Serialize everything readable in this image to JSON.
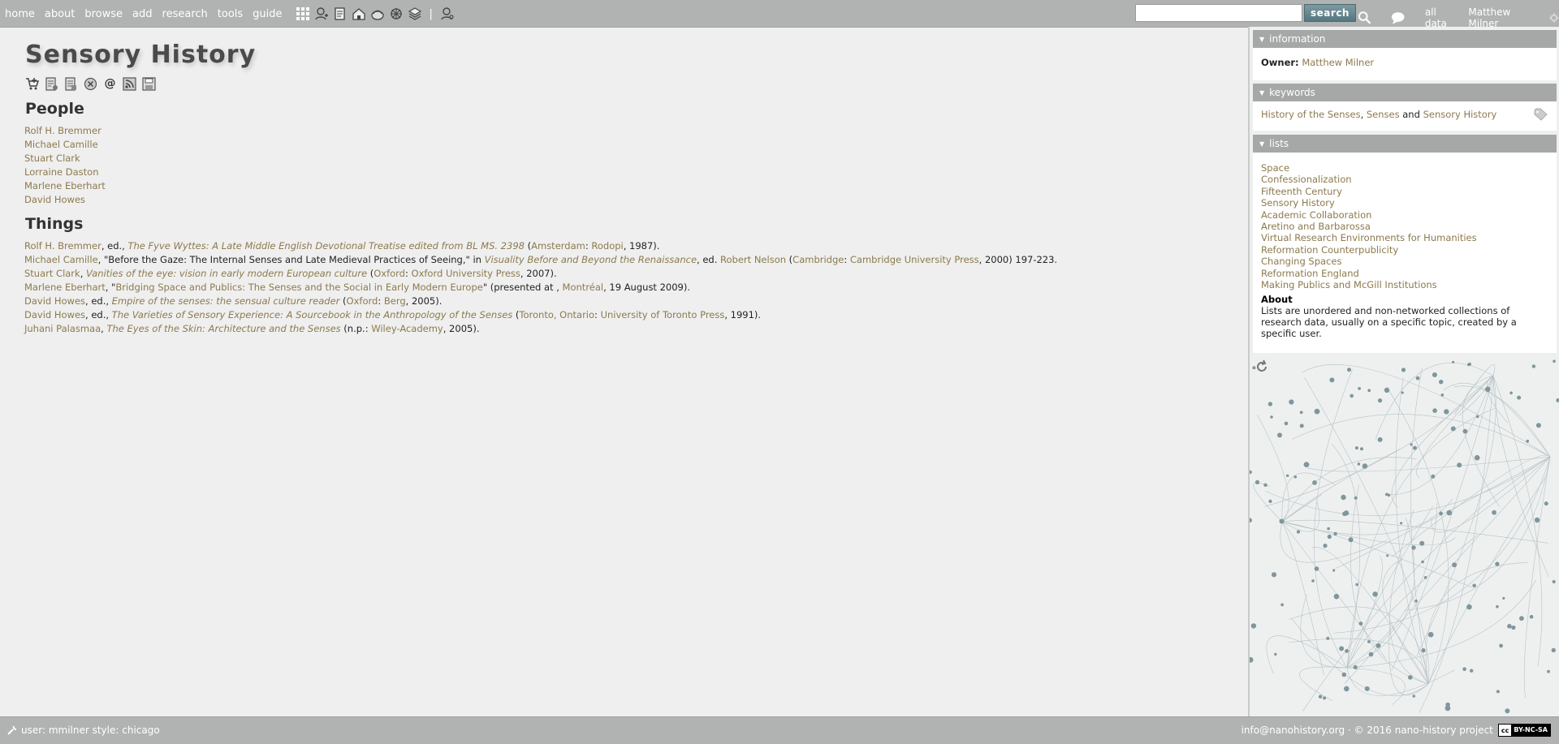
{
  "nav": {
    "links": [
      "home",
      "about",
      "browse",
      "add",
      "research",
      "tools",
      "guide"
    ],
    "separator": "|"
  },
  "search": {
    "value": "",
    "button": "search"
  },
  "top_right": {
    "all_data": "all data",
    "user": "Matthew Milner"
  },
  "page": {
    "title": "Sensory History",
    "people_heading": "People",
    "things_heading": "Things",
    "at_sign": "@"
  },
  "people": [
    "Rolf H. Bremmer",
    "Michael Camille",
    "Stuart Clark",
    "Lorraine Daston",
    "Marlene Eberhart",
    "David Howes"
  ],
  "things": [
    {
      "author": "Rolf H. Bremmer",
      "p1": ", ed., ",
      "title": "The Fyve Wyttes: A Late Middle English Devotional Treatise edited from BL MS. 2398",
      "p2": " (",
      "place": "Amsterdam",
      "p3": ": ",
      "publisher": "Rodopi",
      "p4": ", 1987)."
    },
    {
      "author": "Michael Camille",
      "p1": ", \"Before the Gaze: The Internal Senses and Late Medieval Practices of Seeing,\" in ",
      "title": "Visuality Before and Beyond the Renaissance",
      "p2": ", ed. ",
      "editor": "Robert Nelson",
      "p2b": " (",
      "place": "Cambridge",
      "p3": ": ",
      "publisher": "Cambridge University Press",
      "p4": ", 2000) 197-223."
    },
    {
      "author": "Stuart Clark",
      "p1": ", ",
      "title": "Vanities of the eye: vision in early modern European culture",
      "p2": " (",
      "place": "Oxford",
      "p3": ": ",
      "publisher": "Oxford University Press",
      "p4": ", 2007)."
    },
    {
      "author": "Marlene Eberhart",
      "p1": ", \"",
      "title": "Bridging Space and Publics: The Senses and the Social in Early Modern Europe",
      "p2": "\" (presented at , ",
      "place": "Montréal",
      "p3": ", 19 August 2009).",
      "publisher": "",
      "p4": ""
    },
    {
      "author": "David Howes",
      "p1": ", ed., ",
      "title": "Empire of the senses: the sensual culture reader",
      "p2": " (",
      "place": "Oxford",
      "p3": ": ",
      "publisher": "Berg",
      "p4": ", 2005)."
    },
    {
      "author": "David Howes",
      "p1": ", ed., ",
      "title": "The Varieties of Sensory Experience: A Sourcebook in the Anthropology of the Senses",
      "p2": " (",
      "place": "Toronto, Ontario",
      "p3": ": ",
      "publisher": "University of Toronto Press",
      "p4": ", 1991)."
    },
    {
      "author": "Juhani Palasmaa",
      "p1": ", ",
      "title": "The Eyes of the Skin: Architecture and the Senses",
      "p2": " (n.p.: ",
      "place": "Wiley-Academy",
      "p3": ", 2005).",
      "publisher": "",
      "p4": ""
    }
  ],
  "sidebar": {
    "information": {
      "heading": "information",
      "owner_label": "Owner:",
      "owner": "Matthew Milner"
    },
    "keywords": {
      "heading": "keywords",
      "k1": "History of the Senses",
      "sep1": ", ",
      "k2": "Senses",
      "and": " and ",
      "k3": "Sensory History"
    },
    "lists": {
      "heading": "lists",
      "items": [
        "Space",
        "Confessionalization",
        "Fifteenth Century",
        "Sensory History",
        "Academic Collaboration",
        "Aretino and Barbarossa",
        "Virtual Research Environments for Humanities",
        "Reformation Counterpublicity",
        "Changing Spaces",
        "Reformation England",
        "Making Publics and McGill Institutions"
      ],
      "about_title": "About",
      "about_text": "Lists are unordered and non-networked collections of research data, usually on a specific topic, created by a specific user."
    }
  },
  "footer": {
    "user_style": "user: mmilner style: chicago",
    "email": "info@nanohistory.org",
    "copyright": " · © 2016 nano-history project",
    "license_cc": "cc",
    "license": "BY-NC-SA"
  },
  "colors": {
    "link": "#8c7a4e",
    "bar": "#b1b3b2",
    "panel_head": "#a5a8a7",
    "search_button": "#5f7f88"
  }
}
